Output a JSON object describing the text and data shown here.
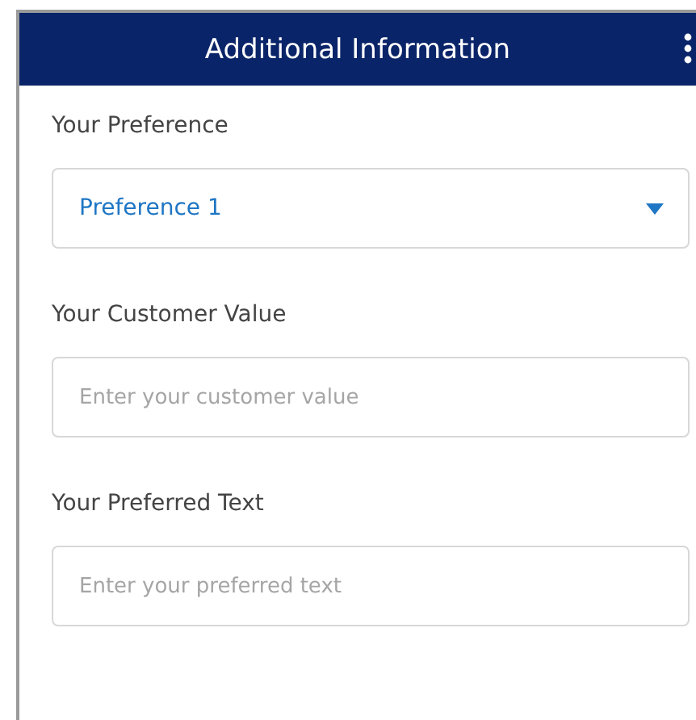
{
  "header": {
    "title": "Additional Information"
  },
  "fields": [
    {
      "kind": "select",
      "label": "Your Preference",
      "value": "Preference 1"
    },
    {
      "kind": "text",
      "label": "Your Customer Value",
      "placeholder": "Enter your customer value"
    },
    {
      "kind": "text",
      "label": "Your Preferred Text",
      "placeholder": "Enter your preferred text"
    }
  ]
}
